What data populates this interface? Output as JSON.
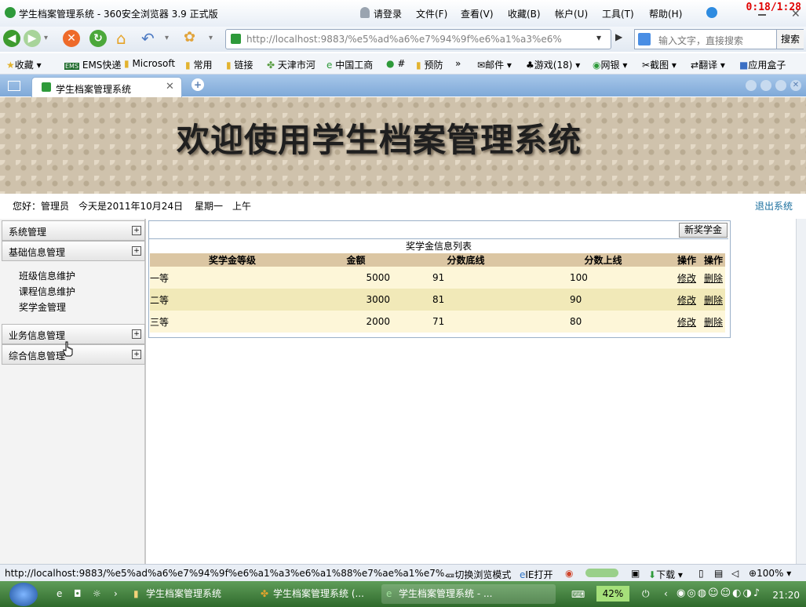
{
  "browser": {
    "window_title": "学生档案管理系统 - 360安全浏览器 3.9 正式版",
    "menu": [
      "请登录",
      "文件(F)",
      "查看(V)",
      "收藏(B)",
      "帐户(U)",
      "工具(T)",
      "帮助(H)"
    ],
    "timer": "0:18/1:28",
    "address": "http://localhost:9883/%e5%ad%a6%e7%94%9f%e6%a1%a3%e6%",
    "search_placeholder": "输入文字，直接搜索",
    "search_button": "搜索",
    "bookmarks": [
      "收藏",
      "EMS快递",
      "Microsoft",
      "常用",
      "链接",
      "天津市河",
      "中国工商",
      "#",
      "预防",
      "»"
    ],
    "bookmarks_right": [
      "邮件",
      "游戏(18)",
      "网银",
      "截图",
      "翻译",
      "应用盒子"
    ],
    "tab_title": "学生档案管理系统",
    "status_url": "http://localhost:9883/%e5%ad%a6%e7%94%9f%e6%a1%a3%e6%a1%88%e7%ae%a1%e7%...",
    "status_items": [
      "切换浏览模式",
      "IE打开",
      "下载",
      "100%"
    ]
  },
  "page": {
    "banner_title": "欢迎使用学生档案管理系统",
    "greeting": "您好：管理员",
    "date_text": "今天是2011年10月24日",
    "weekday": "星期一",
    "period": "上午",
    "logout": "退出系统"
  },
  "sidebar": {
    "sections": [
      {
        "label": "系统管理",
        "toggle": "+"
      },
      {
        "label": "基础信息管理",
        "toggle": "+"
      },
      {
        "label": "业务信息管理",
        "toggle": "+"
      },
      {
        "label": "综合信息管理",
        "toggle": "+"
      }
    ],
    "sub_items": [
      "班级信息维护",
      "课程信息维护",
      "奖学金管理"
    ]
  },
  "main": {
    "new_button": "新奖学金",
    "list_title": "奖学金信息列表",
    "columns": [
      "奖学金等级",
      "金额",
      "分数底线",
      "分数上线",
      "操作",
      "操作"
    ],
    "rows": [
      {
        "level": "一等",
        "amount": "5000",
        "min": "91",
        "max": "100",
        "edit": "修改",
        "delete": "删除"
      },
      {
        "level": "二等",
        "amount": "3000",
        "min": "81",
        "max": "90",
        "edit": "修改",
        "delete": "删除"
      },
      {
        "level": "三等",
        "amount": "2000",
        "min": "71",
        "max": "80",
        "edit": "修改",
        "delete": "删除"
      }
    ]
  },
  "taskbar": {
    "tasks": [
      "学生档案管理系统",
      "学生档案管理系统 (...",
      "学生档案管理系统 - ..."
    ],
    "battery": "42%",
    "clock": "21:20"
  }
}
